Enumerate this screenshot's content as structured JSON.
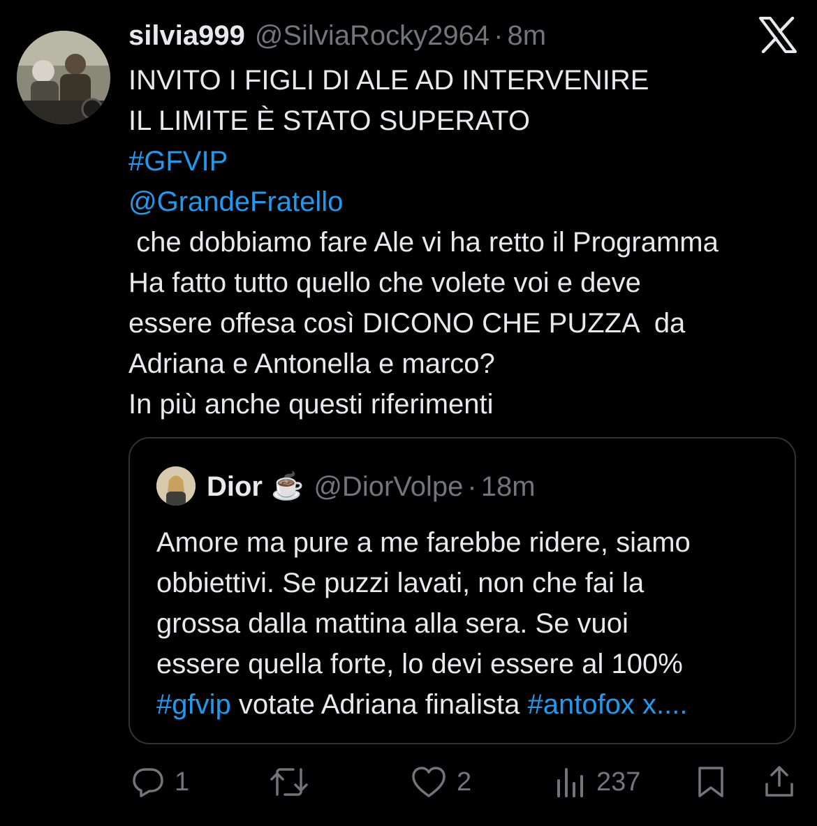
{
  "tweet": {
    "display_name": "silvia999",
    "handle": "@SilviaRocky2964",
    "separator": "·",
    "time": "8m",
    "lines": [
      {
        "text": "INVITO I FIGLI DI ALE AD INTERVENIRE",
        "link": false
      },
      {
        "text": "IL LIMITE È STATO SUPERATO",
        "link": false
      },
      {
        "text": "#GFVIP",
        "link": true
      },
      {
        "text": "@GrandeFratello",
        "link": true
      },
      {
        "text": " che dobbiamo fare Ale vi ha retto il Programma",
        "link": false
      },
      {
        "text": "Ha fatto tutto quello che volete voi e deve",
        "link": false
      },
      {
        "text": "essere offesa così DICONO CHE PUZZA  da",
        "link": false
      },
      {
        "text": "Adriana e Antonella e marco?",
        "link": false
      },
      {
        "text": "In più anche questi riferimenti",
        "link": false
      }
    ]
  },
  "quote": {
    "display_name": "Dior",
    "emoji": "☕️",
    "handle": "@DiorVolpe",
    "separator": "·",
    "time": "18m",
    "lines": [
      "Amore ma pure a me farebbe ridere, siamo",
      "obbiettivi. Se puzzi lavati, non che fai la",
      "grossa dalla mattina alla sera. Se vuoi",
      "essere quella forte, lo devi essere al 100%"
    ],
    "last_line": {
      "tag1": "#gfvip",
      "mid": " votate Adriana finalista ",
      "tag2": "#antofox x...."
    }
  },
  "actions": {
    "replies": "1",
    "retweets": "",
    "likes": "2",
    "views": "237"
  },
  "colors": {
    "background": "#000000",
    "text": "#e7e9ea",
    "muted": "#71767b",
    "link": "#1d9bf0",
    "border": "#2f3336"
  }
}
